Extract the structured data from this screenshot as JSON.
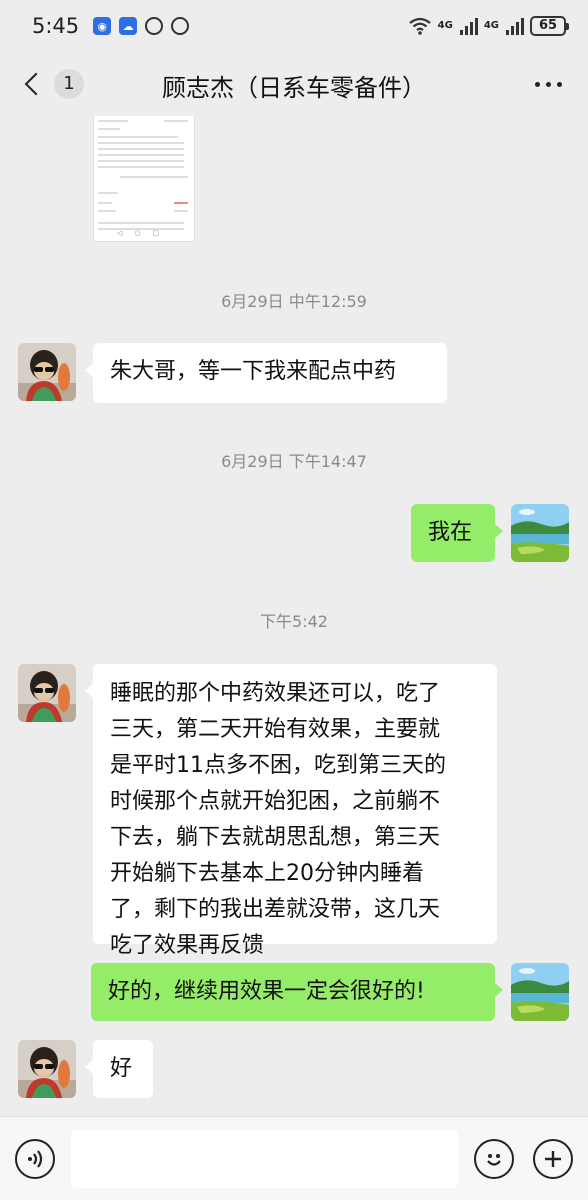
{
  "status_bar": {
    "time": "5:45",
    "net1": "4G",
    "net2": "4G",
    "battery": "65"
  },
  "header": {
    "back_badge": "1",
    "title": "顾志杰（日系车零备件）"
  },
  "messages": [
    {
      "type": "timestamp",
      "text": "6月29日 中午12:59"
    },
    {
      "type": "incoming",
      "text": "朱大哥，等一下我来配点中药"
    },
    {
      "type": "timestamp",
      "text": "6月29日 下午14:47"
    },
    {
      "type": "outgoing",
      "text": "我在"
    },
    {
      "type": "timestamp",
      "text": "下午5:42"
    },
    {
      "type": "incoming",
      "lines": [
        "睡眠的那个中药效果还可以，吃了",
        "三天，第二天开始有效果，主要就",
        "是平时11点多不困，吃到第三天的",
        "时候那个点就开始犯困，之前躺不",
        "下去，躺下去就胡思乱想，第三天",
        "开始躺下去基本上20分钟内睡着",
        "了，剩下的我出差就没带，这几天",
        "吃了效果再反馈"
      ]
    },
    {
      "type": "outgoing",
      "text": "好的，继续用效果一定会很好的!"
    },
    {
      "type": "incoming",
      "text": "好"
    }
  ],
  "input": {
    "value": "",
    "placeholder": ""
  },
  "colors": {
    "outgoing_bubble": "#95ec69",
    "incoming_bubble": "#ffffff",
    "background": "#ededed"
  },
  "icons": [
    "voice-icon",
    "emoji-icon",
    "plus-icon",
    "back-chevron-icon",
    "more-icon"
  ]
}
